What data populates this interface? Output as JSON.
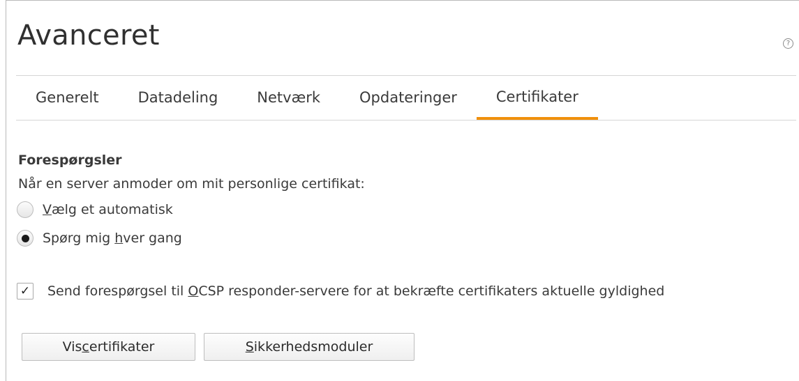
{
  "header": {
    "title": "Avanceret",
    "help_glyph": "?"
  },
  "tabs": [
    {
      "label": "Generelt",
      "selected": false
    },
    {
      "label": "Datadeling",
      "selected": false
    },
    {
      "label": "Netværk",
      "selected": false
    },
    {
      "label": "Opdateringer",
      "selected": false
    },
    {
      "label": "Certifikater",
      "selected": true
    }
  ],
  "requests": {
    "title": "Forespørgsler",
    "description": "Når en server anmoder om mit personlige certifikat:",
    "option_auto": {
      "before": "",
      "accel": "V",
      "after": "ælg et automatisk",
      "checked": false
    },
    "option_ask": {
      "before": "Spørg mig ",
      "accel": "h",
      "after": "ver gang",
      "checked": true
    }
  },
  "ocsp": {
    "before": "Send forespørgsel til ",
    "accel": "O",
    "after": "CSP responder-servere for at bekræfte certifikaters aktuelle gyldighed",
    "checked": true,
    "check_glyph": "✓"
  },
  "buttons": {
    "view_certs": {
      "before": "Vis ",
      "accel": "c",
      "after": "ertifikater"
    },
    "security_modules": {
      "before": "",
      "accel": "S",
      "after": "ikkerhedsmoduler"
    }
  },
  "colors": {
    "accent": "#f0900b",
    "text": "#3a3a3a",
    "divider": "#d5d5d5"
  }
}
